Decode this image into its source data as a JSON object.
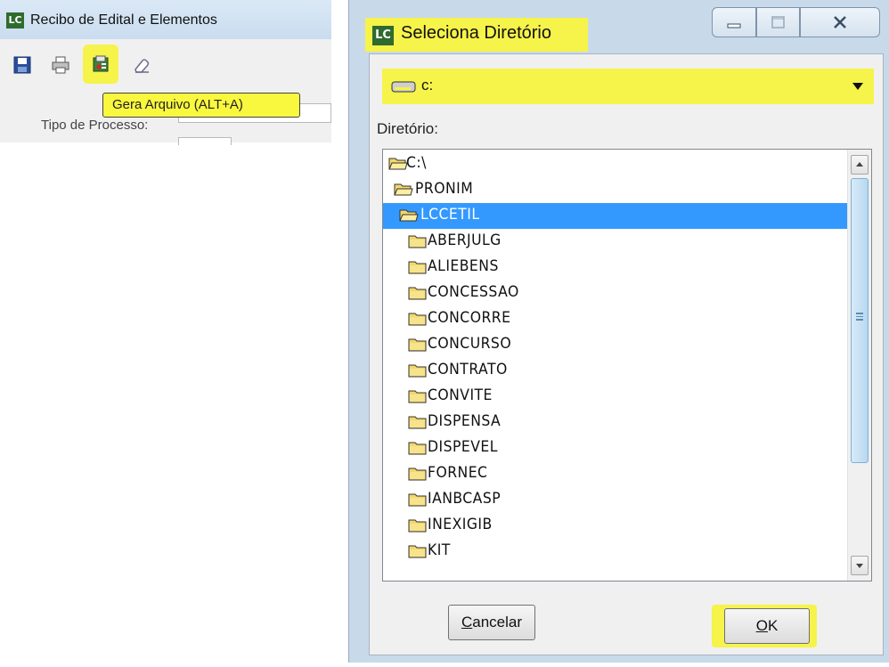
{
  "left_window": {
    "title": "Recibo de Edital e Elementos",
    "logo_text": "LC",
    "toolbar": {
      "icons": [
        "save-icon",
        "print-icon",
        "generate-file-icon",
        "eraser-icon"
      ]
    },
    "tooltip": "Gera Arquivo (ALT+A)",
    "tipo_processo_label": "Tipo de Processo:"
  },
  "dialog": {
    "logo_text": "LC",
    "title": "Seleciona Diretório",
    "drive": "c:",
    "directory_label": "Diretório:",
    "directories": [
      {
        "name": "C:\\",
        "level": 0,
        "open": true
      },
      {
        "name": "PRONIM",
        "level": 1,
        "open": true
      },
      {
        "name": "LCCETIL",
        "level": 2,
        "open": true,
        "selected": true
      },
      {
        "name": "ABERJULG",
        "level": 3
      },
      {
        "name": "ALIEBENS",
        "level": 3
      },
      {
        "name": "CONCESSAO",
        "level": 3
      },
      {
        "name": "CONCORRE",
        "level": 3
      },
      {
        "name": "CONCURSO",
        "level": 3
      },
      {
        "name": "CONTRATO",
        "level": 3
      },
      {
        "name": "CONVITE",
        "level": 3
      },
      {
        "name": "DISPENSA",
        "level": 3
      },
      {
        "name": "DISPEVEL",
        "level": 3
      },
      {
        "name": "FORNEC",
        "level": 3
      },
      {
        "name": "IANBCASP",
        "level": 3
      },
      {
        "name": "INEXIGIB",
        "level": 3
      },
      {
        "name": "KIT",
        "level": 3
      }
    ],
    "buttons": {
      "cancel": "Cancelar",
      "ok": "OK"
    },
    "colors": {
      "highlight": "#f6f34a",
      "selection": "#3399ff",
      "folder": "#f3d76b"
    }
  }
}
